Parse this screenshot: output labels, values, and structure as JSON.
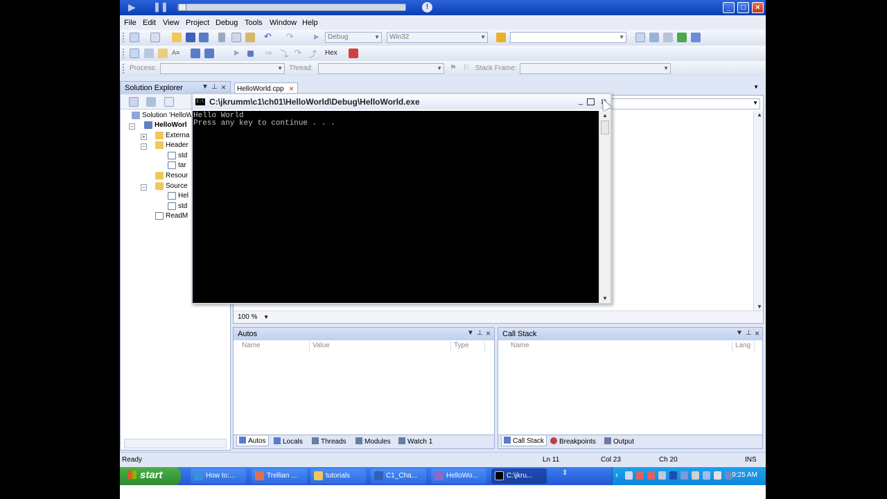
{
  "titlebar": {
    "media_play_icon": "play-icon",
    "media_pause_icon": "pause-icon",
    "info_icon": "info-icon",
    "win_min": "_",
    "win_max": "□",
    "win_close": "×"
  },
  "menu": [
    "File",
    "Edit",
    "View",
    "Project",
    "Debug",
    "Tools",
    "Window",
    "Help"
  ],
  "toolbar": {
    "config": "Debug",
    "platform": "Win32",
    "hex_label": "Hex",
    "process_label": "Process:",
    "thread_label": "Thread:",
    "stack_frame_label": "Stack Frame:"
  },
  "solution_explorer": {
    "title": "Solution Explorer",
    "pin": "⊥",
    "close": "×",
    "tree": [
      {
        "label": "Solution 'HelloW",
        "indent": 0
      },
      {
        "label": "HelloWorl",
        "indent": 1,
        "bold": true
      },
      {
        "label": "Externa",
        "indent": 2
      },
      {
        "label": "Header",
        "indent": 2
      },
      {
        "label": "std",
        "indent": 3
      },
      {
        "label": "tar",
        "indent": 3
      },
      {
        "label": "Resour",
        "indent": 2
      },
      {
        "label": "Source",
        "indent": 2
      },
      {
        "label": "Hel",
        "indent": 3
      },
      {
        "label": "std",
        "indent": 3
      },
      {
        "label": "ReadM",
        "indent": 2
      }
    ]
  },
  "editor": {
    "tab_label": "HelloWorld.cpp",
    "tab_close": "×",
    "zoom": "100 %"
  },
  "console": {
    "title": "C:\\jkrumm\\c1\\ch01\\HelloWorld\\Debug\\HelloWorld.exe",
    "icon_text": "C:\\",
    "line1": "Hello World",
    "line2": "Press any key to continue . . .",
    "min": "_",
    "close": "×"
  },
  "autos": {
    "title": "Autos",
    "columns": [
      "Name",
      "Value",
      "Type"
    ]
  },
  "callstack": {
    "title": "Call Stack",
    "columns": [
      "Name",
      "Lang"
    ]
  },
  "bottom_tabs_left": [
    "Autos",
    "Locals",
    "Threads",
    "Modules",
    "Watch 1"
  ],
  "bottom_tabs_right": [
    "Call Stack",
    "Breakpoints",
    "Output"
  ],
  "status": {
    "ready": "Ready",
    "ln": "Ln 11",
    "col": "Col 23",
    "ch": "Ch 20",
    "mode": "INS"
  },
  "taskbar": {
    "start": "start",
    "tasks": [
      {
        "label": "How to:...",
        "icon": "ie-icon"
      },
      {
        "label": "Trellian ...",
        "icon": "trellian-icon"
      },
      {
        "label": "tutorials",
        "icon": "folder-icon"
      },
      {
        "label": "C1_Cha...",
        "icon": "word-icon"
      },
      {
        "label": "HelloWo...",
        "icon": "vs-icon"
      },
      {
        "label": "C:\\jkru...",
        "icon": "console-icon"
      }
    ],
    "clock": "9:25 AM"
  },
  "colors": {
    "titlebar": "#0a3eb4",
    "ide_bg": "#dfe6f5",
    "console_bg": "#000000",
    "console_text": "#c0c0c0",
    "taskbar": "#2456d4",
    "start": "#3a9a3a"
  }
}
